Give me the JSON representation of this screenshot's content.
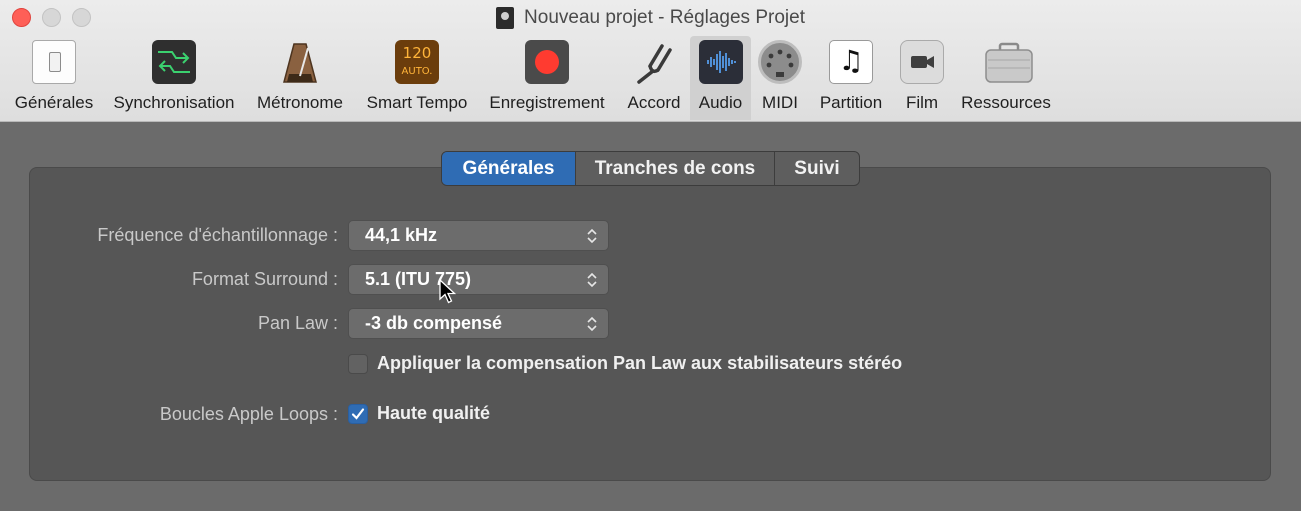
{
  "window": {
    "title": "Nouveau projet - Réglages Projet"
  },
  "toolbar": {
    "items": [
      {
        "label": "Générales",
        "icon": "switch-icon"
      },
      {
        "label": "Synchronisation",
        "icon": "sync-arrows-icon"
      },
      {
        "label": "Métronome",
        "icon": "metronome-icon"
      },
      {
        "label": "Smart Tempo",
        "icon": "smart-tempo-icon",
        "badge_top": "120",
        "badge_bottom": "AUTO."
      },
      {
        "label": "Enregistrement",
        "icon": "record-icon"
      },
      {
        "label": "Accord",
        "icon": "tuning-fork-icon"
      },
      {
        "label": "Audio",
        "icon": "audio-waveform-icon",
        "selected": true
      },
      {
        "label": "MIDI",
        "icon": "midi-connector-icon"
      },
      {
        "label": "Partition",
        "icon": "music-note-icon",
        "glyph": "♫"
      },
      {
        "label": "Film",
        "icon": "movie-camera-icon"
      },
      {
        "label": "Ressources",
        "icon": "briefcase-icon"
      }
    ]
  },
  "tabs": [
    {
      "label": "Générales",
      "selected": true
    },
    {
      "label": "Tranches de cons",
      "selected": false
    },
    {
      "label": "Suivi",
      "selected": false
    }
  ],
  "settings": {
    "sample_rate": {
      "label": "Fréquence d'échantillonnage :",
      "value": "44,1 kHz"
    },
    "surround_format": {
      "label": "Format Surround :",
      "value": "5.1 (ITU 775)"
    },
    "pan_law": {
      "label": "Pan Law :",
      "value": "-3 db compensé"
    },
    "pan_law_compensation": {
      "label": "Appliquer la compensation Pan Law aux stabilisateurs stéréo",
      "checked": false
    },
    "apple_loops": {
      "label": "Boucles Apple Loops :",
      "option_label": "Haute qualité",
      "checked": true
    }
  },
  "colors": {
    "accent": "#2f6cb4",
    "close": "#fe5f57",
    "record": "#ff3b30",
    "background": "#6b6b6b"
  }
}
